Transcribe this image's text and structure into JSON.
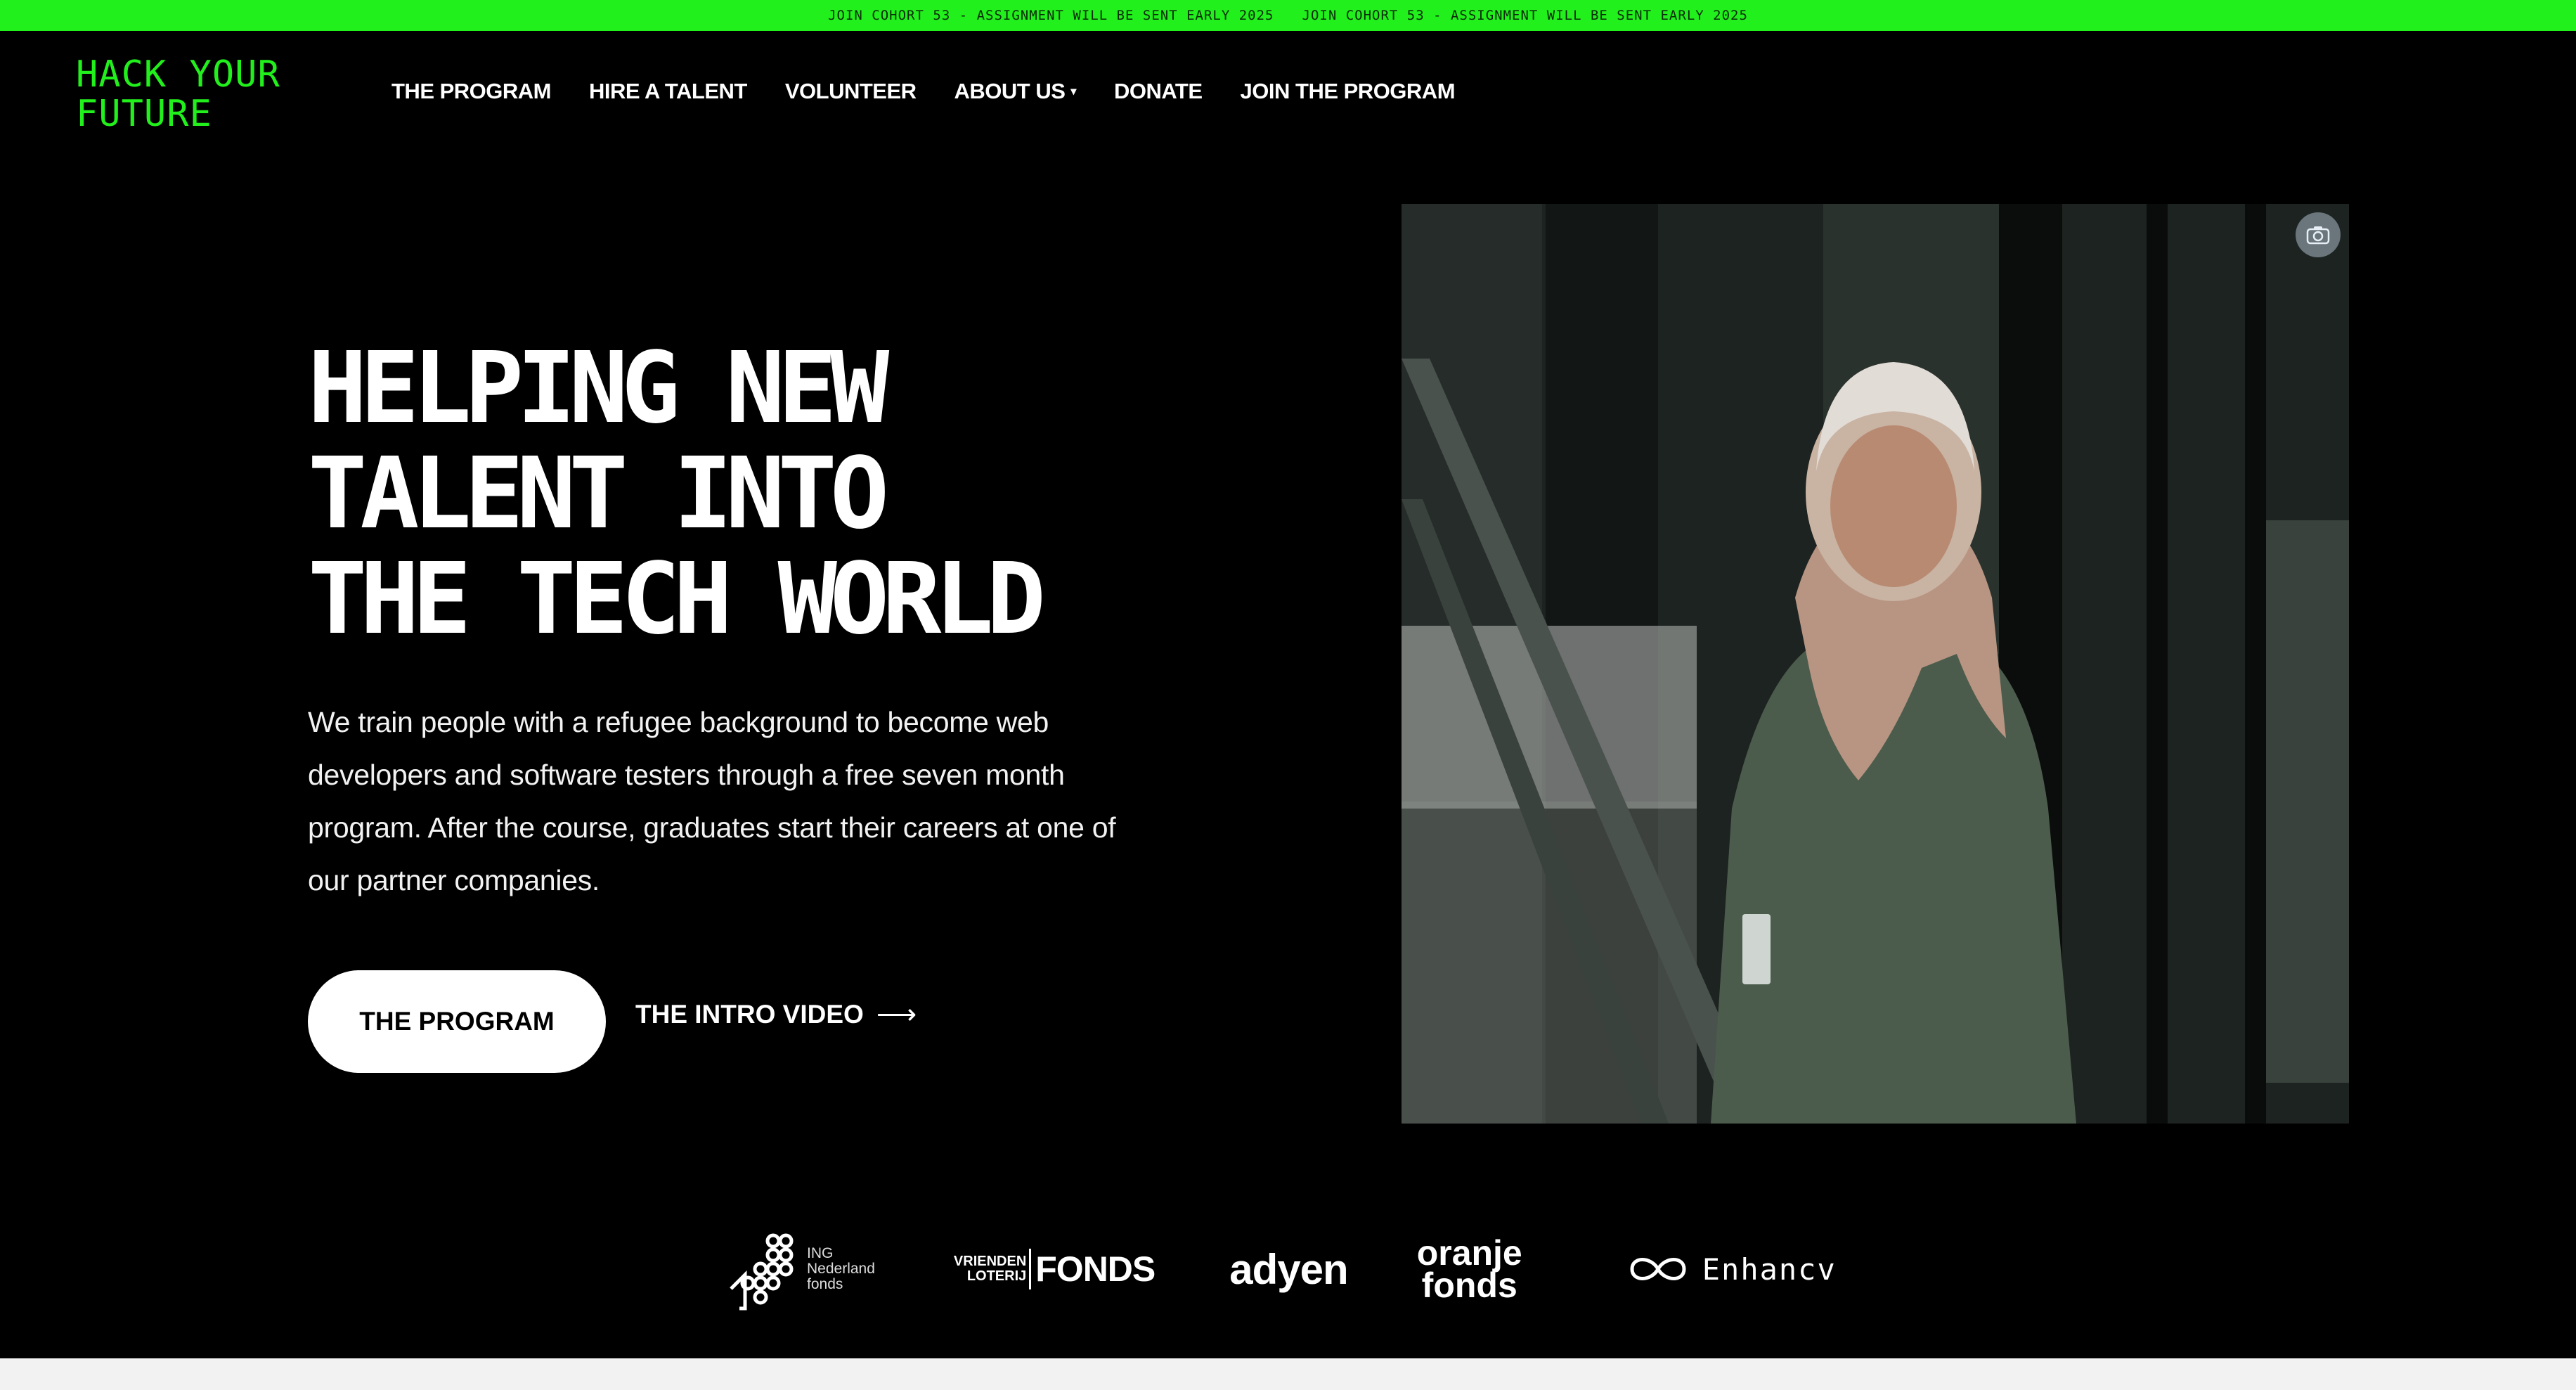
{
  "ticker": {
    "items": [
      "JOIN COHORT 53 - ASSIGNMENT WILL BE SENT EARLY 2025",
      "JOIN COHORT 53 - ASSIGNMENT WILL BE SENT EARLY 2025"
    ]
  },
  "logo": {
    "line1": "HACK YOUR",
    "line2": "FUTURE"
  },
  "nav": {
    "items": [
      {
        "label": "THE PROGRAM"
      },
      {
        "label": "HIRE A TALENT"
      },
      {
        "label": "VOLUNTEER"
      },
      {
        "label": "ABOUT US",
        "caret": "▾"
      },
      {
        "label": "DONATE"
      },
      {
        "label": "JOIN THE PROGRAM"
      }
    ]
  },
  "hero": {
    "headline_lines": [
      "HELPING NEW",
      "TALENT INTO",
      "THE TECH WORLD"
    ],
    "intro": "We train people with a refugee background to become web developers and software testers through a free seven month program. After the course, graduates start their careers at one of our partner companies.",
    "primary_button": "THE PROGRAM",
    "secondary_link": "THE INTRO VIDEO",
    "secondary_arrow": "⟶"
  },
  "photo": {
    "icon": "camera-icon"
  },
  "partners": {
    "ing": {
      "lines": [
        "ING",
        "Nederland",
        "fonds"
      ]
    },
    "vriendenloterij": {
      "small_lines": [
        "VRIENDEN",
        "LOTERIJ"
      ],
      "big": "FONDS"
    },
    "adyen": "adyen",
    "oranje": {
      "lines": [
        "oranje",
        "fonds"
      ]
    },
    "enhancv": "Enhancv"
  },
  "colors": {
    "accent": "#22f01c",
    "background": "#000000",
    "text": "#ffffff"
  }
}
